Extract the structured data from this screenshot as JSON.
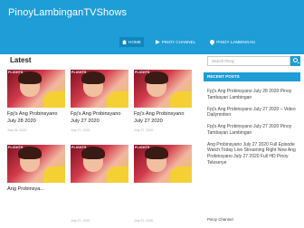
{
  "header": {
    "site_title": "PinoyLambinganTVShows",
    "nav": [
      {
        "label": "HOME",
        "icon": "home-icon"
      },
      {
        "label": "PINOY CHANNEL",
        "icon": "play-icon"
      },
      {
        "label": "PINOY LAMBINGAN",
        "icon": "pin-icon"
      }
    ]
  },
  "main": {
    "section_title": "Latest",
    "cards": [
      {
        "badge": "PLIGHTS",
        "title": "Fpj's Ang Probinsyano July 28 2020",
        "date": "July 28, 2020"
      },
      {
        "badge": "PLIGHTS",
        "title": "Fpj's Ang Probinsyano July 27 2020",
        "date": "July 27, 2020"
      },
      {
        "badge": "PLIGHTS",
        "title": "Fpj's Ang Probinsyano July 27 2020",
        "date": "July 27, 2020"
      },
      {
        "badge": "PLIGHTS",
        "title": "Ang Probinsya...",
        "date": "July 27, 2020"
      },
      {
        "badge": "PLIGHTS",
        "title": "",
        "date": "July 27, 2020"
      },
      {
        "badge": "PLIGHTS",
        "title": "",
        "date": "July 27, 2020"
      }
    ]
  },
  "sidebar": {
    "search_placeholder": "Search Pinoy",
    "recent_title": "RECENT POSTS",
    "recent_posts": [
      "Fpj's Ang Probinsyano July 28 2020 Pinoy Tambayan Lambingan",
      "Fpj's Ang Probinsyano July 27 2020 – Video Dailymotion",
      "Fpj's Ang Probinsyano July 27 2020 Pinoy Tambayan Lambingan",
      "Ang Probinsyano July 27 2020 Full Episode Watch Today Live Streaming Right Now Ang Probinsyano July 27 2020 Full HD Pinoy Teleserye"
    ],
    "channel_label": "Pinoy Channel"
  },
  "colors": {
    "accent": "#1e9dd6",
    "accent_dark": "#0f86bd"
  }
}
